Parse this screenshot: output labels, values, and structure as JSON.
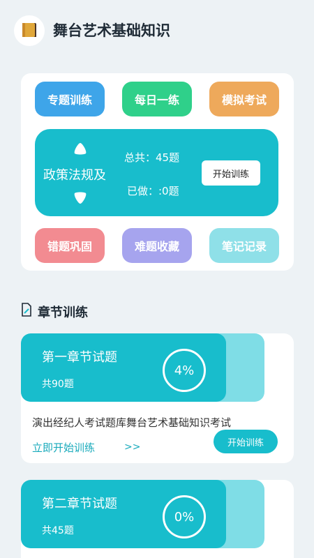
{
  "app": {
    "title": "舞台艺术基础知识"
  },
  "top_buttons": [
    {
      "label": "专题训练",
      "color": "#3ea5e9"
    },
    {
      "label": "每日一练",
      "color": "#2fd08a"
    },
    {
      "label": "模拟考试",
      "color": "#eea95b"
    }
  ],
  "policy": {
    "name": "政策法规及",
    "total": "总共：45题",
    "done": "已做：:0题",
    "start_label": "开始训练"
  },
  "bottom_buttons": [
    {
      "label": "错题巩固",
      "color": "#f28b91"
    },
    {
      "label": "难题收藏",
      "color": "#a6a4ee"
    },
    {
      "label": "笔记记录",
      "color": "#8fe0e8"
    }
  ],
  "chapters": {
    "section_title": "章节训练",
    "items": [
      {
        "title": "第一章节试题",
        "count": "共90题",
        "progress": "4%",
        "description": "演出经纪人考试题库舞台艺术基础知识考试",
        "link": "立即开始训练",
        "arrows": ">>",
        "start_label": "开始训练"
      },
      {
        "title": "第二章节试题",
        "count": "共45题",
        "progress": "0%"
      }
    ]
  },
  "colors": {
    "accent": "#18bdcc",
    "accent_light": "#7fdde6",
    "background": "#edf2f5"
  }
}
